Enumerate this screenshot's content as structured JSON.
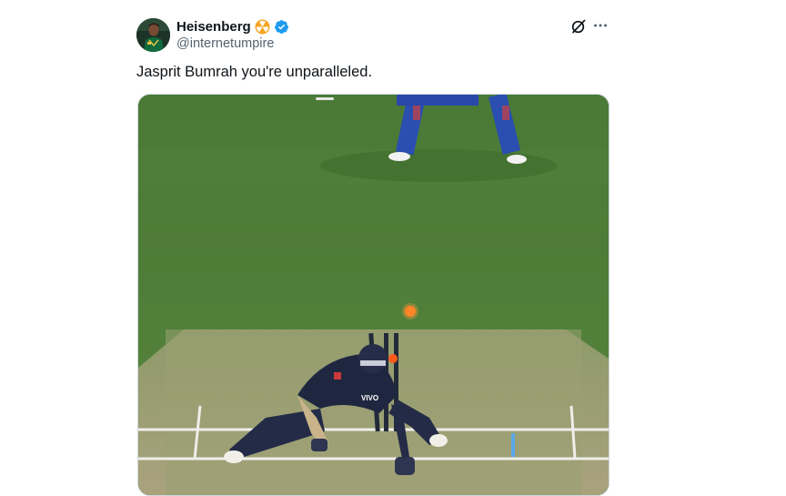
{
  "author": {
    "display_name": "Heisenberg",
    "handle": "@internetumpire",
    "avatar": "avatar-photo",
    "badges": [
      "radiation-badge-icon",
      "verified-check-icon"
    ],
    "colors": {
      "verified": "#1d9bf0",
      "radiation_badge": "#f5a623"
    }
  },
  "actions": {
    "grok_icon": "grok-icon",
    "more_icon": "more-icon"
  },
  "tweet": {
    "text": "Jasprit Bumrah you're unparalleled."
  },
  "media": {
    "type": "video-still",
    "description_icon": "cricket-video-frame"
  },
  "colors": {
    "text_primary": "#0f1419",
    "text_secondary": "#536471",
    "media_border": "#cfd9de"
  }
}
